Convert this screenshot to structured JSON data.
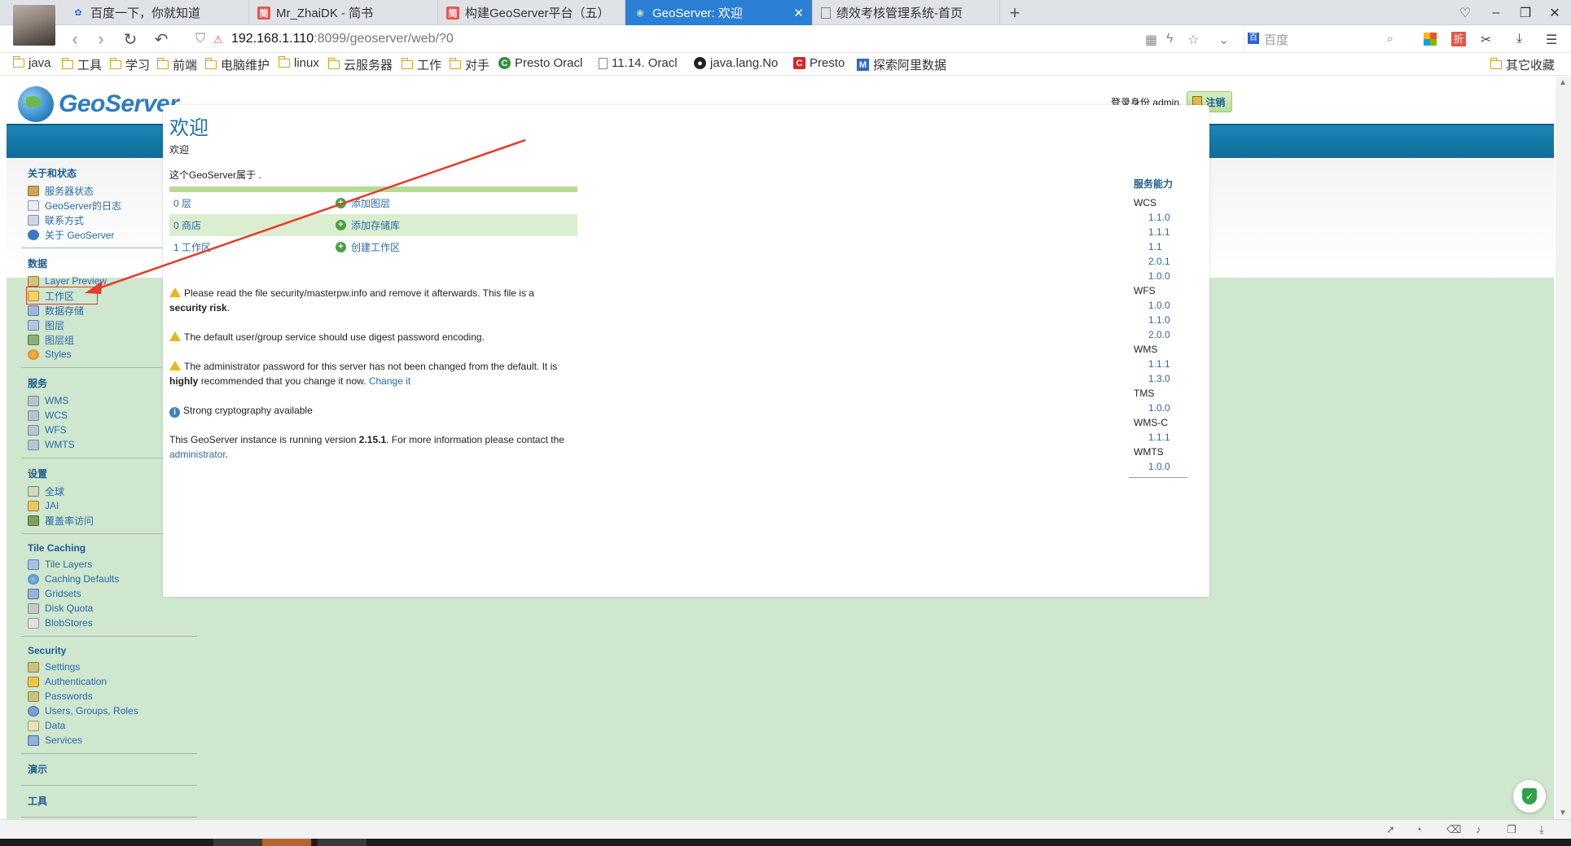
{
  "browser": {
    "tabs": [
      {
        "label": "百度一下，你就知道",
        "icon": "baidu-paw-icon"
      },
      {
        "label": "Mr_ZhaiDK - 简书",
        "icon": "jianshu-icon"
      },
      {
        "label": "构建GeoServer平台（五）",
        "icon": "jianshu-icon"
      },
      {
        "label": "GeoServer: 欢迎",
        "icon": "geoserver-icon"
      },
      {
        "label": "绩效考核管理系统-首页",
        "icon": "page-icon"
      }
    ],
    "url_host": "192.168.1.110",
    "url_path": ":8099/geoserver/web/?0",
    "search_placeholder": "百度",
    "bookmarks": [
      {
        "label": "java",
        "type": "folder"
      },
      {
        "label": "工具",
        "type": "folder"
      },
      {
        "label": "学习",
        "type": "folder"
      },
      {
        "label": "前端",
        "type": "folder"
      },
      {
        "label": "电脑维护",
        "type": "folder"
      },
      {
        "label": "linux",
        "type": "folder"
      },
      {
        "label": "云服务器",
        "type": "folder"
      },
      {
        "label": "工作",
        "type": "folder"
      },
      {
        "label": "对手",
        "type": "folder"
      },
      {
        "label": "Presto Oracl",
        "type": "site"
      },
      {
        "label": "11.14. Oracl",
        "type": "page"
      },
      {
        "label": "java.lang.No",
        "type": "github"
      },
      {
        "label": "Presto",
        "type": "site"
      },
      {
        "label": "探索阿里数据",
        "type": "site"
      }
    ],
    "other_bookmarks": "其它收藏"
  },
  "header": {
    "logo_text": "GeoServer",
    "login_text": "登录身份 admin.",
    "logout_label": "注销"
  },
  "sidebar": {
    "groups": [
      {
        "title": "关于和状态",
        "items": [
          {
            "label": "服务器状态",
            "icon": "cfg"
          },
          {
            "label": "GeoServer的日志",
            "icon": "log"
          },
          {
            "label": "联系方式",
            "icon": "contact"
          },
          {
            "label": "关于 GeoServer",
            "icon": "about"
          }
        ]
      },
      {
        "title": "数据",
        "items": [
          {
            "label": "Layer Preview",
            "icon": "preview"
          },
          {
            "label": "工作区",
            "icon": "fold"
          },
          {
            "label": "数据存储",
            "icon": "store"
          },
          {
            "label": "图层",
            "icon": "layer"
          },
          {
            "label": "图层组",
            "icon": "lgroup"
          },
          {
            "label": "Styles",
            "icon": "style"
          }
        ]
      },
      {
        "title": "服务",
        "items": [
          {
            "label": "WMS",
            "icon": "svc"
          },
          {
            "label": "WCS",
            "icon": "svc"
          },
          {
            "label": "WFS",
            "icon": "svc"
          },
          {
            "label": "WMTS",
            "icon": "svc"
          }
        ]
      },
      {
        "title": "设置",
        "items": [
          {
            "label": "全球",
            "icon": "globe"
          },
          {
            "label": "JAI",
            "icon": "jai"
          },
          {
            "label": "覆盖率访问",
            "icon": "cov"
          }
        ]
      },
      {
        "title": "Tile Caching",
        "items": [
          {
            "label": "Tile Layers",
            "icon": "tiles"
          },
          {
            "label": "Caching Defaults",
            "icon": "cache"
          },
          {
            "label": "Gridsets",
            "icon": "grid"
          },
          {
            "label": "Disk Quota",
            "icon": "disk"
          },
          {
            "label": "BlobStores",
            "icon": "blob"
          }
        ]
      },
      {
        "title": "Security",
        "items": [
          {
            "label": "Settings",
            "icon": "key"
          },
          {
            "label": "Authentication",
            "icon": "shield"
          },
          {
            "label": "Passwords",
            "icon": "key"
          },
          {
            "label": "Users, Groups, Roles",
            "icon": "user"
          },
          {
            "label": "Data",
            "icon": "data"
          },
          {
            "label": "Services",
            "icon": "svcs"
          }
        ]
      },
      {
        "title": "演示",
        "items": []
      },
      {
        "title": "工具",
        "items": []
      }
    ]
  },
  "main": {
    "title": "欢迎",
    "subtitle": "欢迎",
    "owner_line": "这个GeoServer属于 .",
    "stats": [
      {
        "count": "0 层",
        "action": "添加图层"
      },
      {
        "count": "0 商店",
        "action": "添加存储库"
      },
      {
        "count": "1 工作区",
        "action": "创建工作区"
      }
    ],
    "warnings": {
      "w1_text": "Please read the file security/masterpw.info and remove it afterwards. This file is a",
      "w1_bold": "security risk",
      "w2_text": "The default user/group service should use digest password encoding.",
      "w3_text": "The administrator password for this server has not been changed from the default. It is",
      "w3_bold": "highly",
      "w3_rest": "recommended that you change it now.",
      "w3_link": "Change it",
      "info_text": "Strong cryptography available",
      "version_pre": "This GeoServer instance is running version",
      "version": "2.15.1",
      "version_post": ". For more information please contact the",
      "admin_link": "administrator"
    }
  },
  "capabilities": {
    "title": "服务能力",
    "services": [
      {
        "name": "WCS",
        "versions": [
          "1.1.0",
          "1.1.1",
          "1.1",
          "2.0.1",
          "1.0.0"
        ]
      },
      {
        "name": "WFS",
        "versions": [
          "1.0.0",
          "1.1.0",
          "2.0.0"
        ]
      },
      {
        "name": "WMS",
        "versions": [
          "1.1.1",
          "1.3.0"
        ]
      },
      {
        "name": "TMS",
        "versions": [
          "1.0.0"
        ]
      },
      {
        "name": "WMS-C",
        "versions": [
          "1.1.1"
        ]
      },
      {
        "name": "WMTS",
        "versions": [
          "1.0.0"
        ]
      }
    ]
  },
  "colors": {
    "accent_blue": "#1d6ea8",
    "header_band": "#1c86b7",
    "sidebar_bg": "#cfe6cf",
    "annotation_red": "#e53b2c",
    "active_tab": "#2b7fd4"
  }
}
